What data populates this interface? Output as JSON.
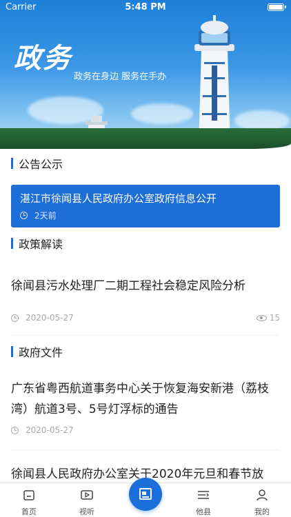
{
  "status_bar": {
    "carrier": "Carrier",
    "time": "5:48 PM"
  },
  "hero": {
    "title": "政务",
    "subtitle": "政务在身边 服务在手办"
  },
  "sections": {
    "notice": "公告公示",
    "policy": "政策解读",
    "documents": "政府文件"
  },
  "notice_card": {
    "title": "湛江市徐闻县人民政府办公室政府信息公开",
    "time": "2天前"
  },
  "policy_article": {
    "title": "徐闻县污水处理厂二期工程社会稳定风险分析",
    "date": "2020-05-27",
    "views": "15"
  },
  "documents_articles": [
    {
      "title": "广东省粤西航道事务中心关于恢复海安新港（荔枝湾）航道3号、5号灯浮标的通告",
      "date": "2020-05-27"
    },
    {
      "title": "徐闻县人民政府办公室关于2020年元旦和春节放"
    }
  ],
  "tabbar": {
    "items": [
      {
        "label": "首页",
        "icon": "home-icon"
      },
      {
        "label": "视听",
        "icon": "video-icon"
      },
      {
        "label": "",
        "icon": "news-icon"
      },
      {
        "label": "他县",
        "icon": "list-icon"
      },
      {
        "label": "我的",
        "icon": "user-icon"
      }
    ]
  },
  "colors": {
    "primary": "#1a6fd9",
    "card": "#1e6ed8"
  }
}
